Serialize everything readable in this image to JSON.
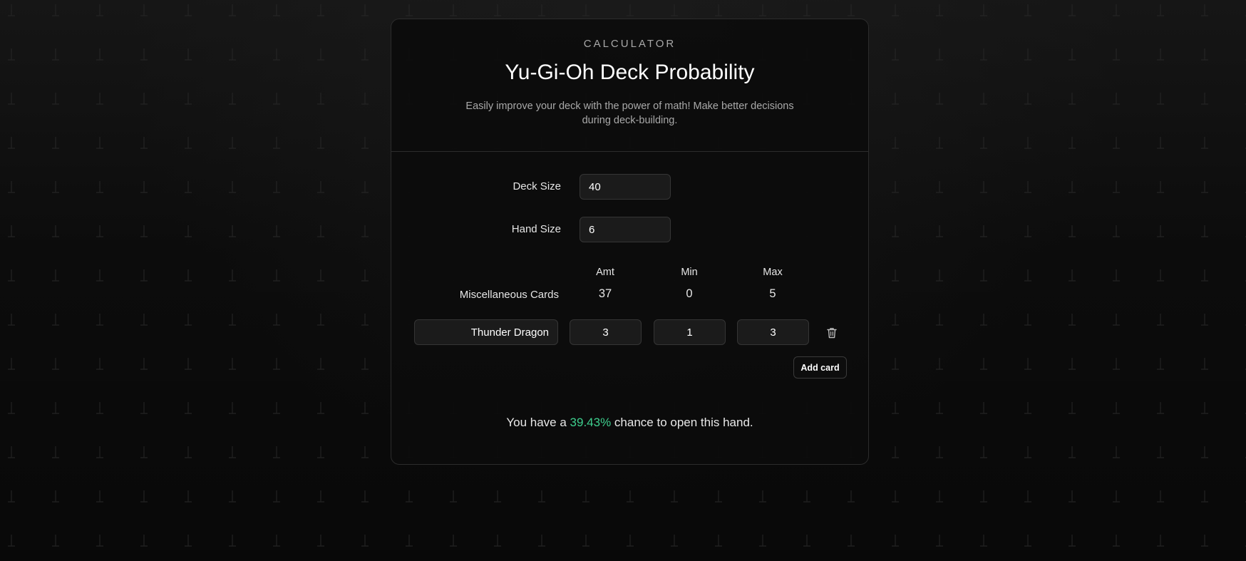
{
  "header": {
    "eyebrow": "CALCULATOR",
    "title": "Yu-Gi-Oh Deck Probability",
    "subtitle": "Easily improve your deck with the power of math! Make better decisions during deck-building."
  },
  "settings": {
    "deck_size_label": "Deck Size",
    "deck_size_value": "40",
    "hand_size_label": "Hand Size",
    "hand_size_value": "6"
  },
  "columns": {
    "amt": "Amt",
    "min": "Min",
    "max": "Max"
  },
  "misc": {
    "label": "Miscellaneous Cards",
    "amt": "37",
    "min": "0",
    "max": "5"
  },
  "cards": [
    {
      "name": "Thunder Dragon",
      "amt": "3",
      "min": "1",
      "max": "3"
    }
  ],
  "actions": {
    "add_card_label": "Add card",
    "delete_icon": "trash-icon"
  },
  "result": {
    "prefix": "You have a ",
    "percent": "39.43%",
    "suffix": " chance to open this hand."
  },
  "colors": {
    "accent": "#3ecf8e",
    "background": "#0c0c0c",
    "border": "#2c2c2c"
  }
}
